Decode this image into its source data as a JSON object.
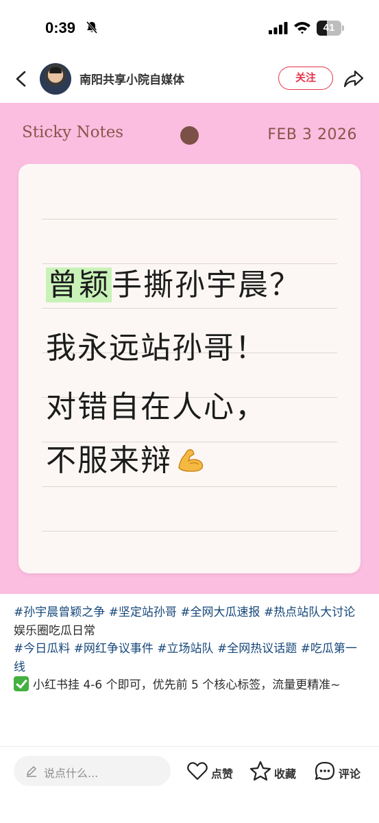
{
  "status_bar": {
    "time": "0:39",
    "battery_level": "41",
    "battery_fraction": 0.41,
    "icons": [
      "bell-slash-icon",
      "signal-icon",
      "wifi-icon",
      "battery-icon"
    ]
  },
  "header": {
    "account_name": "南阳共享小院自媒体",
    "follow_label": "关注",
    "icons": [
      "back-icon",
      "avatar",
      "share-icon"
    ]
  },
  "note": {
    "brand": "Sticky Notes",
    "date": "FEB 3 2026",
    "line1_highlight": "曾颖",
    "line1_rest": "手撕孙宇晨？",
    "line2": "我永远站孙哥！",
    "line3": "对错自在人心，",
    "line4": "不服来辩",
    "line4_emoji": "flexed-biceps-icon",
    "colors": {
      "background": "#fbbde0",
      "card": "#fcf7f4",
      "highlight": "#c9f2b8",
      "accent": "#8a5448"
    }
  },
  "caption": {
    "tags1": [
      "#孙宇晨曾颖之争",
      "#坚定站孙哥",
      "#全网大瓜速报",
      "#热点站队大讨论"
    ],
    "plain1": "娱乐圈吃瓜日常",
    "tags2": [
      "#今日瓜料",
      "#网红争议事件",
      "#立场站队",
      "#全网热议话题",
      "#吃瓜第一线"
    ],
    "tip": "小红书挂 4-6 个即可，优先前 5 个核心标签，流量更精准~",
    "colors": {
      "tag": "#15477a"
    }
  },
  "bottom_bar": {
    "comment_placeholder": "说点什么...",
    "like_label": "点赞",
    "favorite_label": "收藏",
    "comment_label": "评论"
  }
}
